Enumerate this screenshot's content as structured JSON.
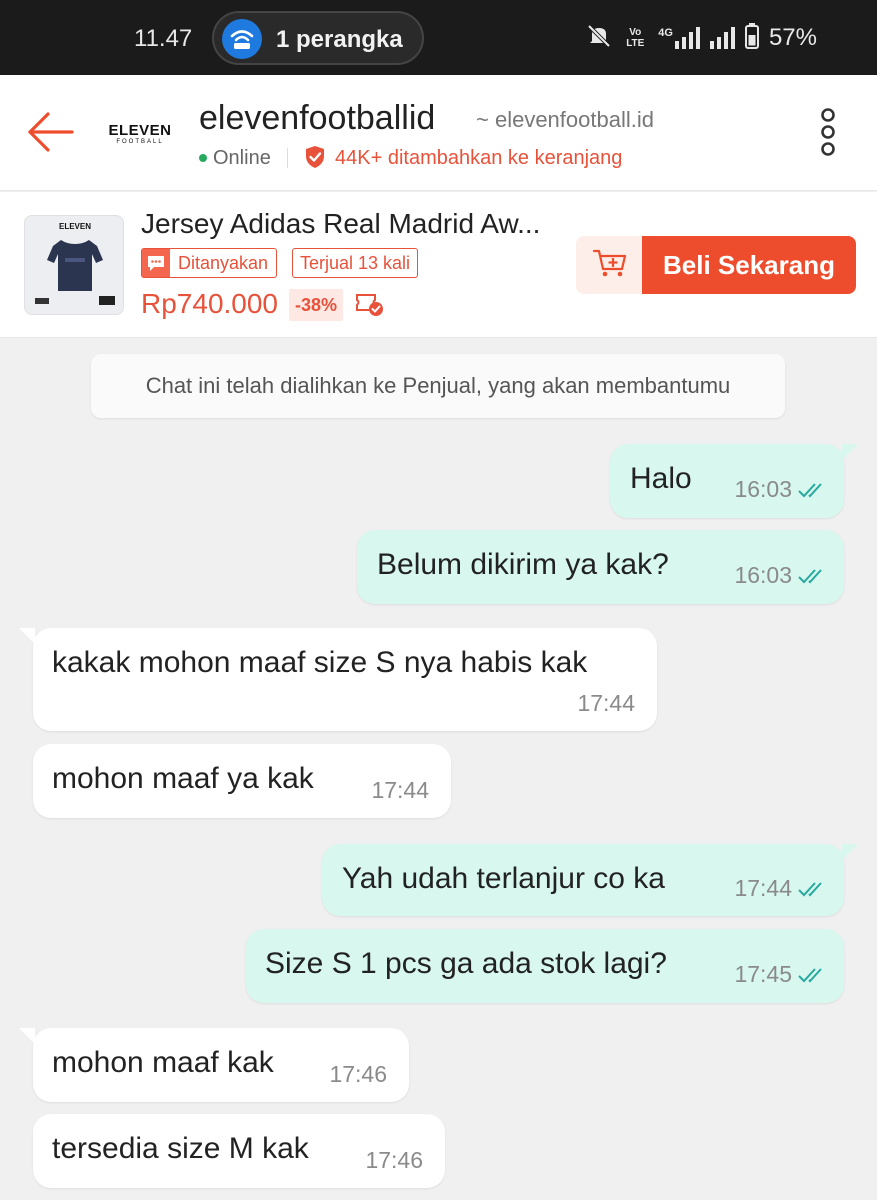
{
  "status_bar": {
    "time": "11.47",
    "pill_text": "1 perangka",
    "battery": "57%",
    "network": "4G",
    "volte": "Vo LTE"
  },
  "header": {
    "back_icon": "arrow-left-icon",
    "logo_main": "ELEVEN",
    "logo_sub": "FOOTBALL",
    "shop_name": "elevenfootballid",
    "shop_domain": "~ elevenfootball.id",
    "online": "Online",
    "cart_stat": "44K+ ditambahkan ke keranjang",
    "more_icon": "more-vertical-icon"
  },
  "product": {
    "title": "Jersey Adidas Real Madrid Aw...",
    "tag_asked": "Ditanyakan",
    "tag_sold": "Terjual 13 kali",
    "price": "Rp740.000",
    "discount": "-38%",
    "cart_icon": "add-to-cart-icon",
    "buy_label": "Beli Sekarang"
  },
  "chat": {
    "notice": "Chat ini telah dialihkan ke Penjual, yang akan membantumu",
    "messages": [
      {
        "text": "Halo",
        "time": "16:03",
        "dir": "out"
      },
      {
        "text": "Belum dikirim ya kak?",
        "time": "16:03",
        "dir": "out"
      },
      {
        "text": "kakak mohon maaf size S nya habis kak",
        "time": "17:44",
        "dir": "in"
      },
      {
        "text": "mohon maaf ya kak",
        "time": "17:44",
        "dir": "in"
      },
      {
        "text": "Yah udah terlanjur co ka",
        "time": "17:44",
        "dir": "out"
      },
      {
        "text": "Size S 1 pcs ga ada stok lagi?",
        "time": "17:45",
        "dir": "out"
      },
      {
        "text": "mohon maaf kak",
        "time": "17:46",
        "dir": "in"
      },
      {
        "text": "tersedia size M kak",
        "time": "17:46",
        "dir": "in"
      }
    ]
  },
  "colors": {
    "accent": "#ee4d2d",
    "outgoing_bubble": "#d7f7ef",
    "incoming_bubble": "#ffffff",
    "read_tick": "#27a9a0"
  }
}
